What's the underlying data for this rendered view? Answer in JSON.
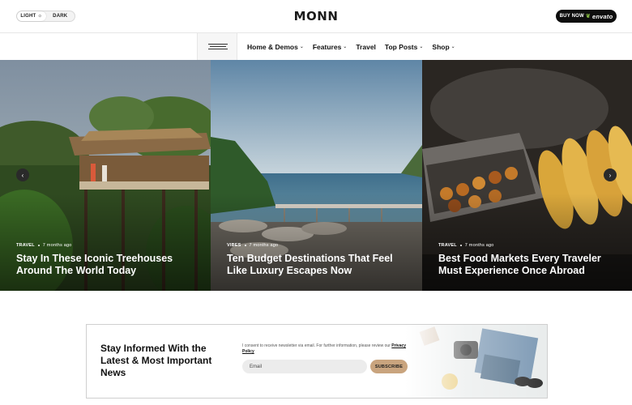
{
  "header": {
    "mode_light": "LIGHT",
    "mode_dark": "DARK",
    "logo": "MONN",
    "buy_now": "BUY NOW",
    "buy_brand": "envato"
  },
  "nav": {
    "items": [
      {
        "label": "Home & Demos",
        "has_dropdown": true
      },
      {
        "label": "Features",
        "has_dropdown": true
      },
      {
        "label": "Travel",
        "has_dropdown": false
      },
      {
        "label": "Top Posts",
        "has_dropdown": true
      },
      {
        "label": "Shop",
        "has_dropdown": true
      }
    ]
  },
  "slider": {
    "slides": [
      {
        "category": "TRAVEL",
        "time": "7 months ago",
        "title": "Stay In These Iconic Treehouses Around The World Today"
      },
      {
        "category": "VIBES",
        "time": "7 months ago",
        "title": "Ten Budget Destinations That Feel Like Luxury Escapes Now"
      },
      {
        "category": "TRAVEL",
        "time": "7 months ago",
        "title": "Best Food Markets Every Traveler Must Experience Once Abroad"
      }
    ]
  },
  "newsletter": {
    "title": "Stay Informed With the Latest & Most Important News",
    "consent_text": "I consent to receive newsletter via email. For further information, please review our",
    "privacy_link": "Privacy Policy",
    "email_placeholder": "Email",
    "subscribe_label": "SUBSCRIBE"
  },
  "colors": {
    "accent": "#c9a47e",
    "dark": "#0d0d0d"
  }
}
